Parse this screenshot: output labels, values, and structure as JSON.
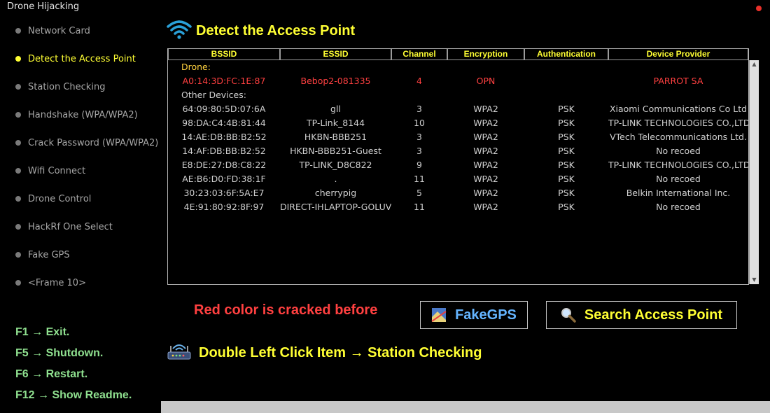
{
  "app": {
    "title": "Drone Hijacking"
  },
  "sidebar": {
    "items": [
      {
        "label": "Network Card",
        "active": false
      },
      {
        "label": "Detect the Access Point",
        "active": true
      },
      {
        "label": "Station Checking",
        "active": false
      },
      {
        "label": "Handshake (WPA/WPA2)",
        "active": false
      },
      {
        "label": "Crack Password (WPA/WPA2)",
        "active": false
      },
      {
        "label": "Wifi Connect",
        "active": false
      },
      {
        "label": "Drone Control",
        "active": false
      },
      {
        "label": "HackRf One Select",
        "active": false
      },
      {
        "label": "Fake GPS",
        "active": false
      },
      {
        "label": "<Frame 10>",
        "active": false
      }
    ]
  },
  "shortcuts": [
    "F1 → Exit.",
    "F5 → Shutdown.",
    "F6 → Restart.",
    "F12 → Show Readme."
  ],
  "main": {
    "title": "Detect the Access Point",
    "title_icon": "wifi-icon",
    "table": {
      "columns": [
        "BSSID",
        "ESSID",
        "Channel",
        "Encryption",
        "Authentication",
        "Device Provider"
      ],
      "drone_label": "Drone:",
      "drone_rows": [
        {
          "bssid": "A0:14:3D:FC:1E:87",
          "essid": "Bebop2-081335",
          "channel": "4",
          "encryption": "OPN",
          "auth": "",
          "provider": "PARROT SA"
        }
      ],
      "other_label": "Other Devices:",
      "other_rows": [
        {
          "bssid": "64:09:80:5D:07:6A",
          "essid": "gll",
          "channel": "3",
          "encryption": "WPA2",
          "auth": "PSK",
          "provider": "Xiaomi Communications Co Ltd"
        },
        {
          "bssid": "98:DA:C4:4B:81:44",
          "essid": "TP-Link_8144",
          "channel": "10",
          "encryption": "WPA2",
          "auth": "PSK",
          "provider": "TP-LINK TECHNOLOGIES CO.,LTD"
        },
        {
          "bssid": "14:AE:DB:BB:B2:52",
          "essid": "HKBN-BBB251",
          "channel": "3",
          "encryption": "WPA2",
          "auth": "PSK",
          "provider": "VTech Telecommunications Ltd."
        },
        {
          "bssid": "14:AF:DB:BB:B2:52",
          "essid": "HKBN-BBB251-Guest",
          "channel": "3",
          "encryption": "WPA2",
          "auth": "PSK",
          "provider": "No recoed"
        },
        {
          "bssid": "E8:DE:27:D8:C8:22",
          "essid": "TP-LINK_D8C822",
          "channel": "9",
          "encryption": "WPA2",
          "auth": "PSK",
          "provider": "TP-LINK TECHNOLOGIES CO.,LTD"
        },
        {
          "bssid": "AE:B6:D0:FD:38:1F",
          "essid": ".",
          "channel": "11",
          "encryption": "WPA2",
          "auth": "PSK",
          "provider": "No recoed"
        },
        {
          "bssid": "30:23:03:6F:5A:E7",
          "essid": "cherrypig",
          "channel": "5",
          "encryption": "WPA2",
          "auth": "PSK",
          "provider": "Belkin International Inc."
        },
        {
          "bssid": "4E:91:80:92:8F:97",
          "essid": "DIRECT-IHLAPTOP-GOLUVMsJ",
          "channel": "11",
          "encryption": "WPA2",
          "auth": "PSK",
          "provider": "No recoed"
        }
      ]
    },
    "note": "Red color is cracked before",
    "buttons": {
      "fake_gps": {
        "label": "FakeGPS",
        "icon": "map-icon"
      },
      "search": {
        "label": "Search Access Point",
        "icon": "magnifier-icon"
      }
    },
    "hint": {
      "text": "Double Left Click Item → Station Checking",
      "icon": "router-icon"
    }
  },
  "colors": {
    "background": "#000000",
    "accent": "#ffff33",
    "cracked": "#ff4040",
    "shortcut": "#8fe08f",
    "button_blue": "#64b4ff"
  }
}
